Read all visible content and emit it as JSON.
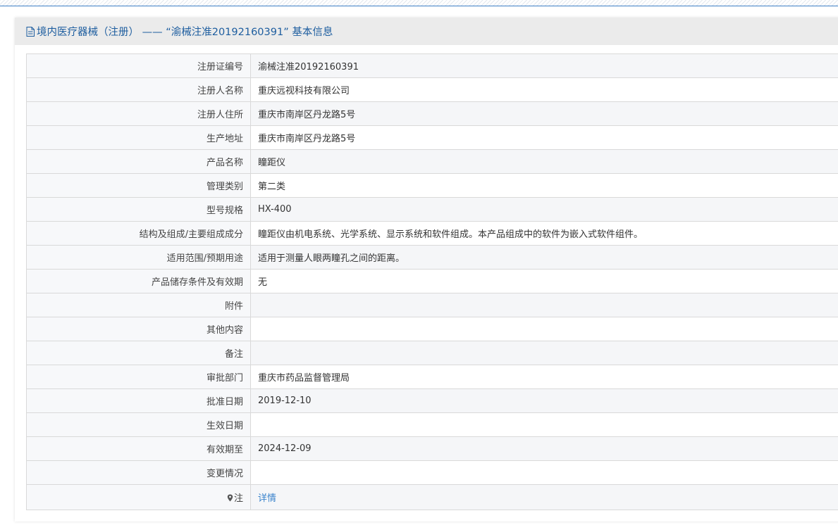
{
  "header": {
    "title": "境内医疗器械（注册） —— “渝械注准20192160391” 基本信息"
  },
  "rows": [
    {
      "label": "注册证编号",
      "value": "渝械注准20192160391"
    },
    {
      "label": "注册人名称",
      "value": "重庆远视科技有限公司"
    },
    {
      "label": "注册人住所",
      "value": "重庆市南岸区丹龙路5号"
    },
    {
      "label": "生产地址",
      "value": "重庆市南岸区丹龙路5号"
    },
    {
      "label": "产品名称",
      "value": "瞳距仪"
    },
    {
      "label": "管理类别",
      "value": "第二类"
    },
    {
      "label": "型号规格",
      "value": "HX-400"
    },
    {
      "label": "结构及组成/主要组成成分",
      "value": "瞳距仪由机电系统、光学系统、显示系统和软件组成。本产品组成中的软件为嵌入式软件组件。"
    },
    {
      "label": "适用范围/预期用途",
      "value": "适用于测量人眼两瞳孔之间的距离。"
    },
    {
      "label": "产品储存条件及有效期",
      "value": "无"
    },
    {
      "label": "附件",
      "value": ""
    },
    {
      "label": "其他内容",
      "value": ""
    },
    {
      "label": "备注",
      "value": ""
    },
    {
      "label": "审批部门",
      "value": "重庆市药品监督管理局"
    },
    {
      "label": "批准日期",
      "value": "2019-12-10"
    },
    {
      "label": "生效日期",
      "value": ""
    },
    {
      "label": "有效期至",
      "value": "2024-12-09"
    },
    {
      "label": "变更情况",
      "value": ""
    }
  ],
  "note_row": {
    "label": "注",
    "link": "详情"
  },
  "icons": {
    "header": "document-icon",
    "note": "location-pin-icon"
  },
  "colors": {
    "accent": "#1d5d9f",
    "link": "#3a83cc",
    "border": "#d9d9d9",
    "header_bg": "#ebebeb"
  }
}
